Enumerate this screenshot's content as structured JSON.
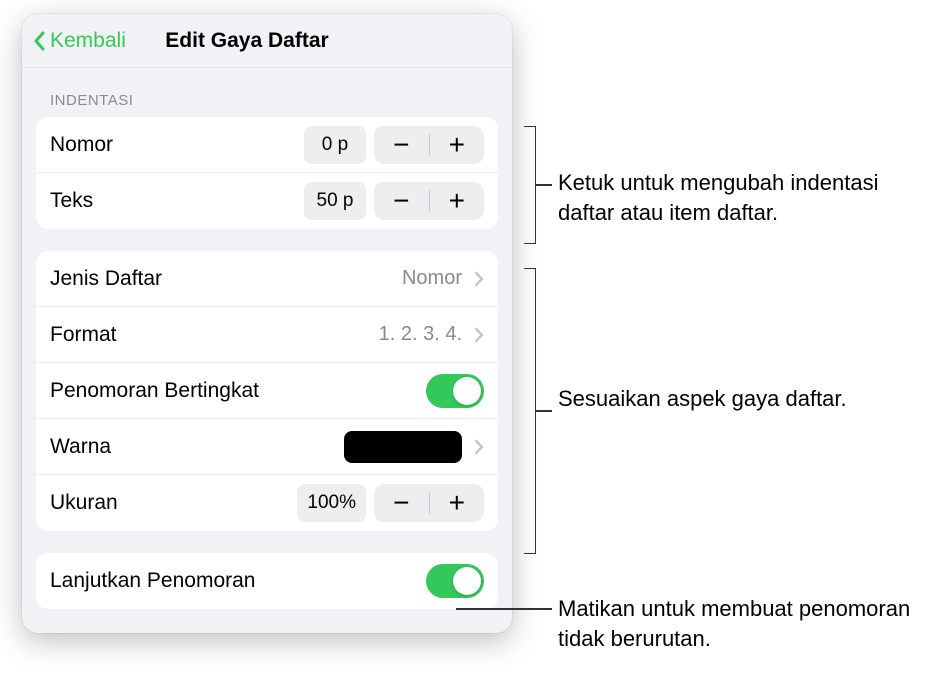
{
  "header": {
    "back": "Kembali",
    "title": "Edit Gaya Daftar"
  },
  "section_indent": {
    "label": "INDENTASI",
    "rows": {
      "number": {
        "label": "Nomor",
        "value": "0 p"
      },
      "text": {
        "label": "Teks",
        "value": "50 p"
      }
    }
  },
  "section_style": {
    "list_type": {
      "label": "Jenis Daftar",
      "value": "Nomor"
    },
    "format": {
      "label": "Format",
      "value": "1. 2. 3. 4."
    },
    "tiered": {
      "label": "Penomoran Bertingkat",
      "on": true
    },
    "color": {
      "label": "Warna",
      "hex": "#000000"
    },
    "size": {
      "label": "Ukuran",
      "value": "100%"
    }
  },
  "section_continue": {
    "label": "Lanjutkan Penomoran",
    "on": true
  },
  "callouts": {
    "c1": "Ketuk untuk mengubah indentasi daftar atau item daftar.",
    "c2": "Sesuaikan aspek gaya daftar.",
    "c3": "Matikan untuk membuat penomoran tidak berurutan."
  }
}
